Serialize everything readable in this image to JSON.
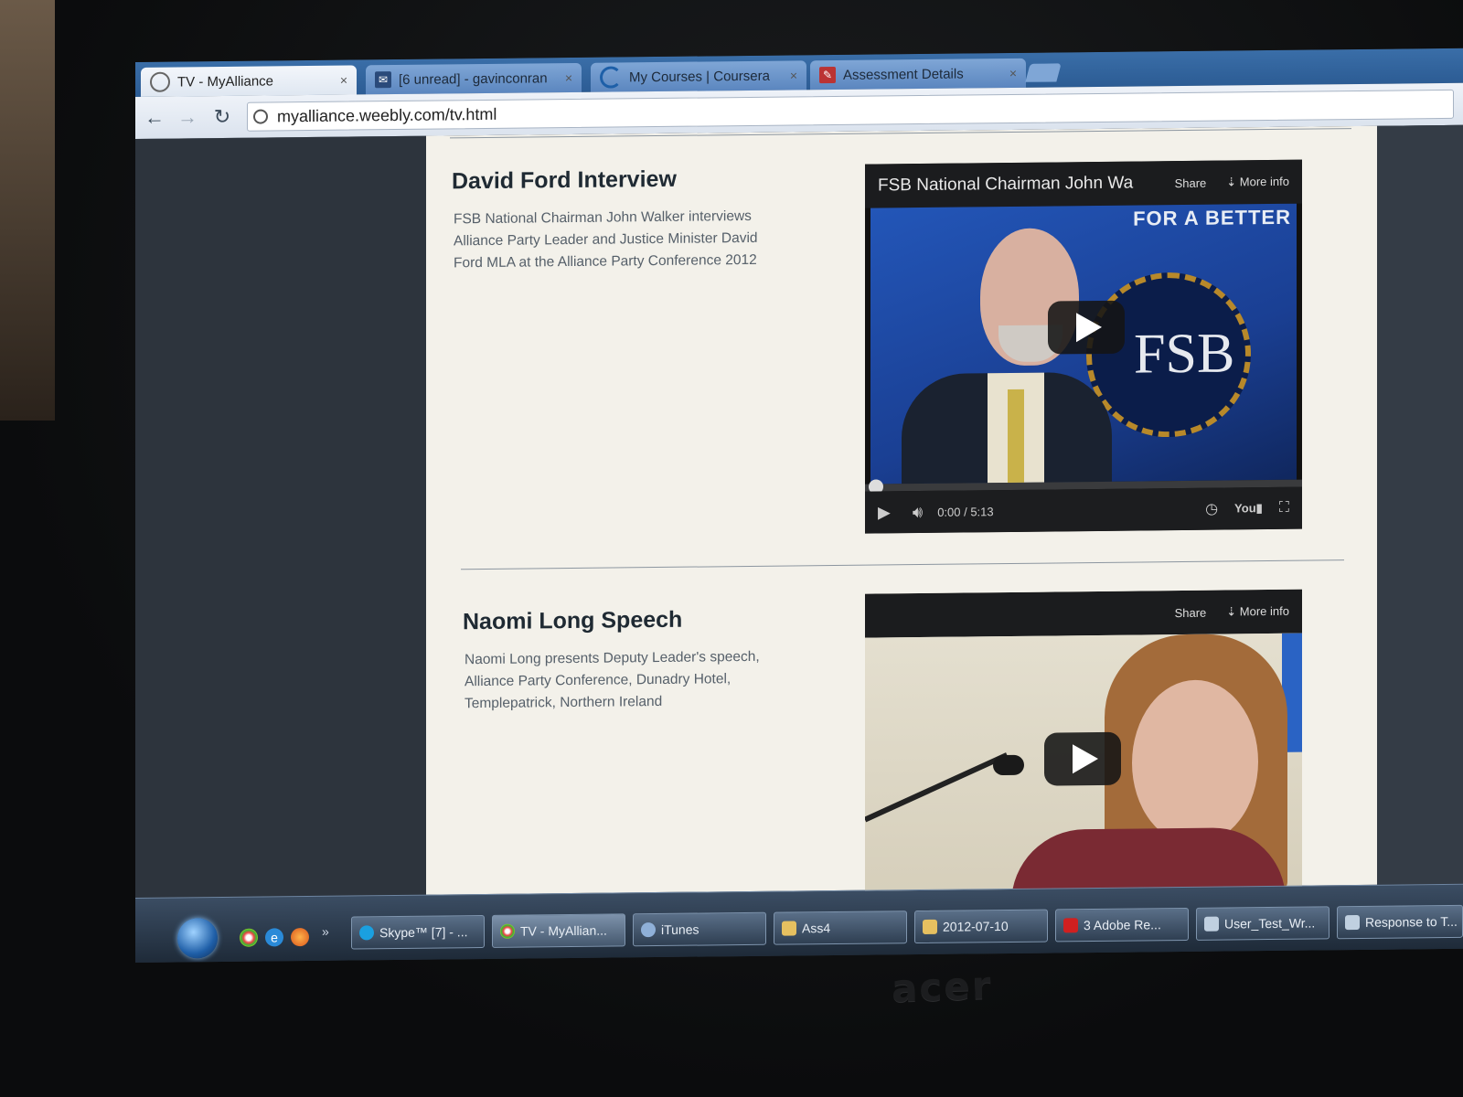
{
  "browser": {
    "tabs": [
      {
        "label": "TV - MyAlliance",
        "active": true,
        "icon": "globe-icon"
      },
      {
        "label": "[6 unread] - gavinconran",
        "active": false,
        "icon": "mail-icon"
      },
      {
        "label": "My Courses | Coursera",
        "active": false,
        "icon": "coursera-icon"
      },
      {
        "label": "Assessment Details",
        "active": false,
        "icon": "assessment-icon"
      }
    ],
    "url": "myalliance.weebly.com/tv.html"
  },
  "sections": [
    {
      "title": "David Ford Interview",
      "description": "FSB National Chairman John Walker interviews Alliance Party Leader and Justice Minister David Ford MLA at the Alliance Party Conference 2012",
      "video": {
        "title": "FSB National Chairman John Wa",
        "share": "Share",
        "more_info": "More info",
        "time": "0:00 / 5:13",
        "banner_text": "FOR A BETTER",
        "logo_text": "FSB"
      }
    },
    {
      "title": "Naomi Long Speech",
      "description": "Naomi Long presents Deputy Leader's speech, Alliance Party Conference, Dunadry Hotel, Templepatrick, Northern Ireland",
      "video": {
        "share": "Share",
        "more_info": "More info"
      }
    }
  ],
  "taskbar": {
    "buttons": [
      {
        "label": "Skype™ [7] - ...",
        "color": "#1aa0e0"
      },
      {
        "label": "TV - MyAllian...",
        "color": "#e0a020"
      },
      {
        "label": "iTunes",
        "color": "#8fb0d8"
      },
      {
        "label": "Ass4",
        "color": "#e6c060"
      },
      {
        "label": "2012-07-10",
        "color": "#e6c060"
      },
      {
        "label": "3 Adobe Re...",
        "color": "#d02020"
      },
      {
        "label": "User_Test_Wr...",
        "color": "#c0d0e0"
      },
      {
        "label": "Response to T...",
        "color": "#c0d0e0"
      }
    ]
  },
  "monitor": {
    "brand": "acer"
  }
}
